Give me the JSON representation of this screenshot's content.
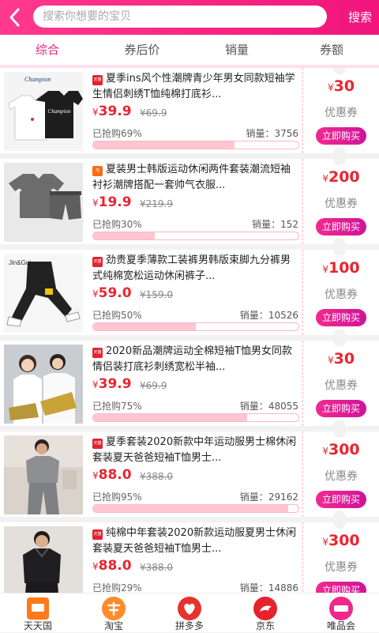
{
  "header": {
    "back_icon": "chevron-left-icon",
    "search_placeholder": "搜索你想要的宝贝",
    "search_button": "搜索"
  },
  "tabs": [
    {
      "label": "综合",
      "active": true
    },
    {
      "label": "券后价"
    },
    {
      "label": "销量"
    },
    {
      "label": "券额"
    }
  ],
  "products": [
    {
      "badge": "天猫",
      "badge_color": "#e4222d",
      "title": "夏季ins风个性潮牌青少年男女同款短袖学生情侣刺绣T恤纯棉打底衫...",
      "currency": "¥",
      "price": "39.9",
      "original": "¥69.9",
      "grab_label": "已抢购",
      "grab_pct": "69%",
      "grab_fraction": 0.69,
      "sales_label": "销量：",
      "sales": "3756",
      "coupon_currency": "¥",
      "coupon": "30",
      "coupon_label": "优惠券",
      "buy_label": "立即购买",
      "image": "two t-shirts white and black"
    },
    {
      "badge": "淘",
      "badge_color": "#ff6a10",
      "title": "夏装男士韩版运动休闲两件套装潮流短袖衬衫潮牌搭配一套帅气衣服...",
      "currency": "¥",
      "price": "19.9",
      "original": "¥219.9",
      "grab_label": "已抢购",
      "grab_pct": "30%",
      "grab_fraction": 0.3,
      "sales_label": "销量：",
      "sales": "152",
      "coupon_currency": "¥",
      "coupon": "200",
      "coupon_label": "优惠券",
      "buy_label": "立即购买",
      "image": "grey tshirt and shorts set"
    },
    {
      "badge": "天猫",
      "badge_color": "#e4222d",
      "title": "劲贵夏季薄款工装裤男韩版束脚九分裤男式纯棉宽松运动休闲裤子...",
      "currency": "¥",
      "price": "59.0",
      "original": "¥159.0",
      "grab_label": "已抢购",
      "grab_pct": "50%",
      "grab_fraction": 0.5,
      "sales_label": "销量：",
      "sales": "10526",
      "coupon_currency": "¥",
      "coupon": "100",
      "coupon_label": "优惠券",
      "buy_label": "立即购买",
      "image": "black cargo pants",
      "image_text": "Jin&Gui"
    },
    {
      "badge": "天猫",
      "badge_color": "#e4222d",
      "title": "2020新品潮牌运动全棉短袖T恤男女同款情侣装打底衫刺绣宽松半袖...",
      "currency": "¥",
      "price": "39.9",
      "original": "¥69.9",
      "grab_label": "已抢购",
      "grab_pct": "75%",
      "grab_fraction": 0.75,
      "sales_label": "销量：",
      "sales": "48055",
      "coupon_currency": "¥",
      "coupon": "30",
      "coupon_label": "优惠券",
      "buy_label": "立即购买",
      "image": "couple in white tshirts"
    },
    {
      "badge": "天猫",
      "badge_color": "#e4222d",
      "title": "夏季套装2020新款中年运动服男士棉休闲套装夏天爸爸短袖T恤男士...",
      "currency": "¥",
      "price": "88.0",
      "original": "¥388.0",
      "grab_label": "已抢购",
      "grab_pct": "95%",
      "grab_fraction": 0.95,
      "sales_label": "销量：",
      "sales": "29162",
      "coupon_currency": "¥",
      "coupon": "300",
      "coupon_label": "优惠券",
      "buy_label": "立即购买",
      "image": "man in grey sports set"
    },
    {
      "badge": "天猫",
      "badge_color": "#e4222d",
      "title": "纯棉中年套装2020新款运动服夏男士休闲套装夏天爸爸短袖T恤男士...",
      "currency": "¥",
      "price": "88.0",
      "original": "¥388.0",
      "grab_label": "已抢购",
      "grab_pct": "29%",
      "grab_fraction": 0.29,
      "sales_label": "销量：",
      "sales": "14886",
      "coupon_currency": "¥",
      "coupon": "300",
      "coupon_label": "优惠券",
      "buy_label": "立即购买",
      "image": "man in black polo set"
    }
  ],
  "bottom_nav": [
    {
      "label": "天天国",
      "icon": "tiantian-mall-icon",
      "color": "#ff7a1a"
    },
    {
      "label": "淘宝",
      "icon": "taobao-icon",
      "color": "#ff8b2a"
    },
    {
      "label": "拼多多",
      "icon": "pinduoduo-icon",
      "color": "#e8322d"
    },
    {
      "label": "京东",
      "icon": "jd-icon",
      "color": "#e5232d"
    },
    {
      "label": "唯品会",
      "icon": "vipshop-icon",
      "color": "#f0288c"
    }
  ],
  "thumb_logo": "Champion"
}
